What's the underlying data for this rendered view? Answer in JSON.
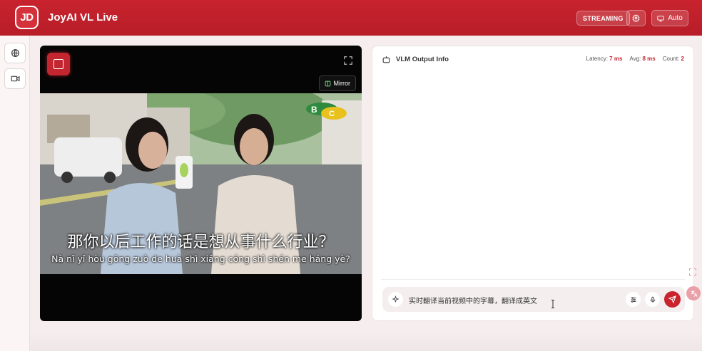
{
  "header": {
    "logo_text": "JD",
    "title": "JoyAI VL Live",
    "status": "STREAMING",
    "mode_label": "Auto"
  },
  "video": {
    "mirror_label": "Mirror",
    "subtitle_zh": "那你以后工作的话是想从事什么行业？",
    "subtitle_pinyin": "Nà nǐ yǐ hòu gōng zuò de huà shì xiǎng cóng shì shén me háng yè?",
    "sign_letters": [
      "B",
      "C"
    ]
  },
  "output": {
    "title": "VLM Output Info",
    "latency_label": "Latency:",
    "latency_value": "7 ms",
    "avg_label": "Avg:",
    "avg_value": "8 ms",
    "count_label": "Count:",
    "count_value": "2"
  },
  "input": {
    "prompt": "实时翻译当前视频中的字幕，翻译成英文"
  },
  "colors": {
    "brand": "#c8232e",
    "accent_value": "#c4262f"
  }
}
